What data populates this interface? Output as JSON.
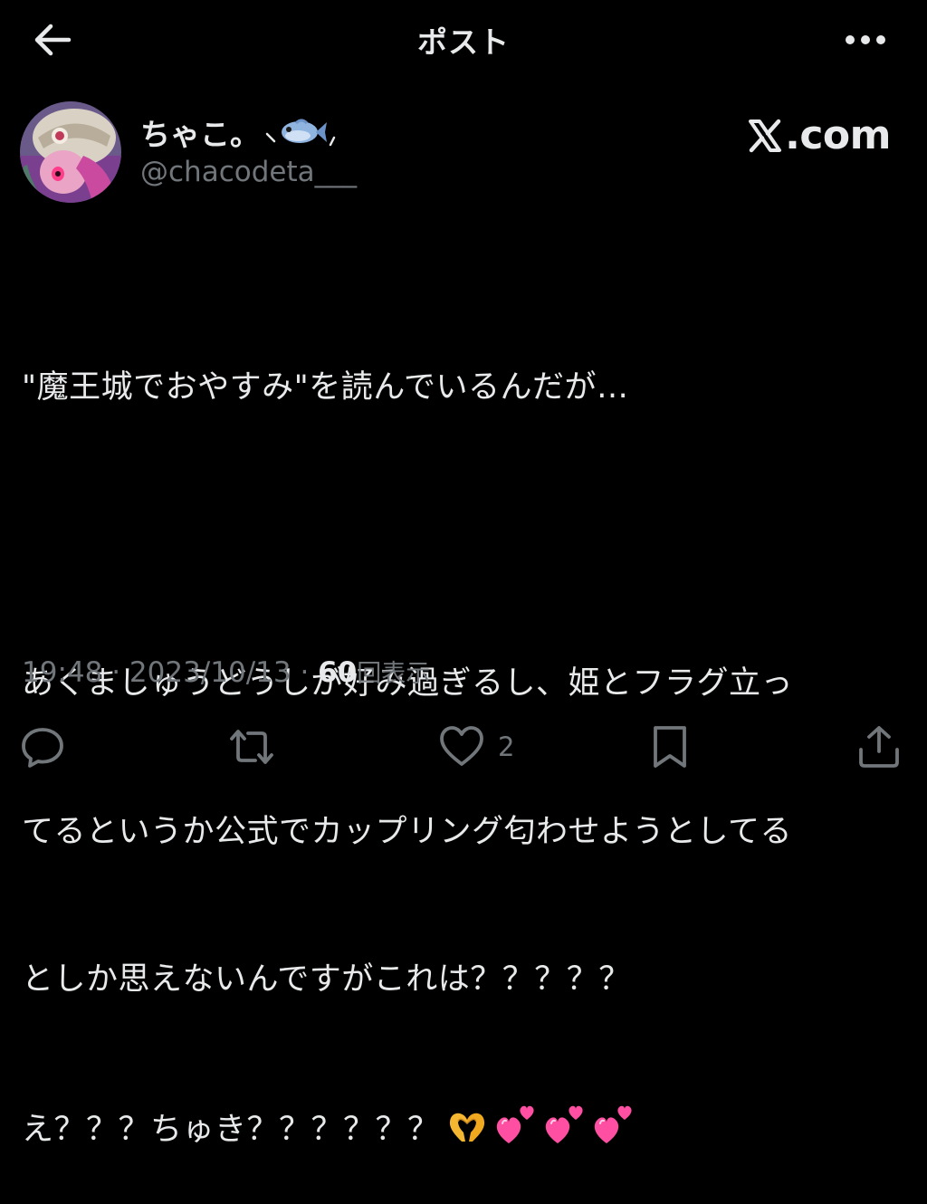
{
  "header": {
    "title": "ポスト"
  },
  "user": {
    "display_name": "ちゃこ。",
    "handle": "@chacodeta___"
  },
  "watermark": {
    "text": ".com"
  },
  "post": {
    "lines": [
      "\"魔王城でおやすみ\"を読んでいるんだが…",
      "",
      "あくましゅうどうしが好み過ぎるし、姫とフラグ立っ",
      "てるというか公式でカップリング匂わせようとしてる",
      "としか思えないんですがこれは？？？？？",
      "え？？？ちゅき？？？？？？"
    ]
  },
  "meta": {
    "time": "19:48",
    "separator1": " · ",
    "date": "2023/10/13",
    "separator2": " · ",
    "views": "60",
    "views_label": "回表示"
  },
  "actions": {
    "reply_count": "",
    "repost_count": "",
    "like_count": "2",
    "bookmark_count": ""
  },
  "colors": {
    "background": "#000000",
    "text": "#e7e9ea",
    "muted": "#71767b",
    "heart_pink": "#ff4fa3"
  }
}
